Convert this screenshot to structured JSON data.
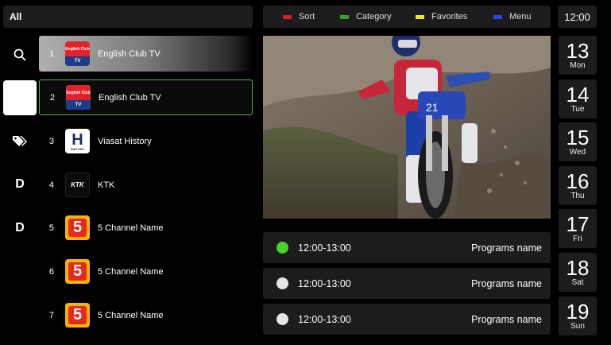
{
  "filter": {
    "label": "All"
  },
  "rail": [
    {
      "name": "search-icon"
    },
    {
      "name": "heart-icon"
    },
    {
      "name": "tag-icon"
    },
    {
      "letter": "D"
    },
    {
      "letter": "D"
    }
  ],
  "channels": [
    {
      "num": "1",
      "name": "English Club TV",
      "logo": "english-club-tv",
      "logo_top": "English Club",
      "logo_bot": "TV"
    },
    {
      "num": "2",
      "name": "English Club TV",
      "logo": "english-club-tv",
      "logo_top": "English Club",
      "logo_bot": "TV"
    },
    {
      "num": "3",
      "name": "Viasat History",
      "logo": "viasat-history",
      "logo_text": "H",
      "logo_sub": "HISTORY"
    },
    {
      "num": "4",
      "name": "KTK",
      "logo": "ktk",
      "logo_text": "KTK"
    },
    {
      "num": "5",
      "name": "5 Channel Name",
      "logo": "channel-5",
      "logo_text": "5"
    },
    {
      "num": "6",
      "name": "5 Channel Name",
      "logo": "channel-5",
      "logo_text": "5"
    },
    {
      "num": "7",
      "name": "5 Channel Name",
      "logo": "channel-5",
      "logo_text": "5"
    }
  ],
  "legend": [
    {
      "label": "Sort",
      "color": "#e11f2a"
    },
    {
      "label": "Category",
      "color": "#3e9e2a"
    },
    {
      "label": "Favorites",
      "color": "#f0e521"
    },
    {
      "label": "Menu",
      "color": "#2449e8"
    }
  ],
  "clock": "12:00",
  "programs": [
    {
      "time": "12:00-13:00",
      "name": "Programs name",
      "live": true
    },
    {
      "time": "12:00-13:00",
      "name": "Programs name",
      "live": false
    },
    {
      "time": "12:00-13:00",
      "name": "Programs name",
      "live": false
    }
  ],
  "dates": [
    {
      "day": "13",
      "weekday": "Mon"
    },
    {
      "day": "14",
      "weekday": "Tue"
    },
    {
      "day": "15",
      "weekday": "Wed"
    },
    {
      "day": "16",
      "weekday": "Thu"
    },
    {
      "day": "17",
      "weekday": "Fri"
    },
    {
      "day": "18",
      "weekday": "Sat"
    },
    {
      "day": "19",
      "weekday": "Sun"
    }
  ]
}
